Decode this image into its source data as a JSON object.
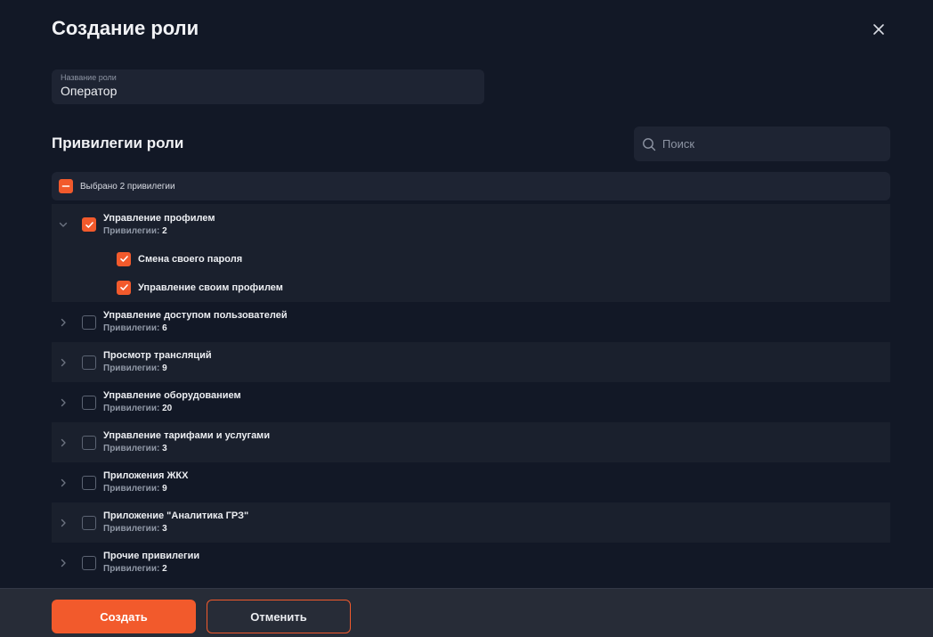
{
  "dialog": {
    "title": "Создание роли"
  },
  "role_name": {
    "label": "Название роли",
    "value": "Оператор"
  },
  "privileges": {
    "title": "Привилегии роли",
    "search_placeholder": "Поиск",
    "selection_text": "Выбрано 2 привилегии",
    "meta_label": "Привилегии:",
    "groups": [
      {
        "name": "Управление профилем",
        "count": "2",
        "checked": true,
        "expanded": true,
        "items": [
          {
            "name": "Смена своего пароля",
            "checked": true
          },
          {
            "name": "Управление своим профилем",
            "checked": true
          }
        ]
      },
      {
        "name": "Управление доступом пользователей",
        "count": "6",
        "checked": false
      },
      {
        "name": "Просмотр трансляций",
        "count": "9",
        "checked": false
      },
      {
        "name": "Управление оборудованием",
        "count": "20",
        "checked": false
      },
      {
        "name": "Управление тарифами и услугами",
        "count": "3",
        "checked": false
      },
      {
        "name": "Приложения ЖКХ",
        "count": "9",
        "checked": false
      },
      {
        "name": "Приложение \"Аналитика ГРЗ\"",
        "count": "3",
        "checked": false
      },
      {
        "name": "Прочие привилегии",
        "count": "2",
        "checked": false
      }
    ]
  },
  "footer": {
    "create_label": "Создать",
    "cancel_label": "Отменить"
  },
  "colors": {
    "accent": "#f25a2c",
    "background": "#121826",
    "surface": "#1e2433"
  },
  "icons": {
    "close": "close-icon",
    "search": "search-icon",
    "chevron_down": "chevron-down-icon",
    "chevron_right": "chevron-right-icon",
    "check": "check-icon",
    "minus": "minus-icon"
  }
}
